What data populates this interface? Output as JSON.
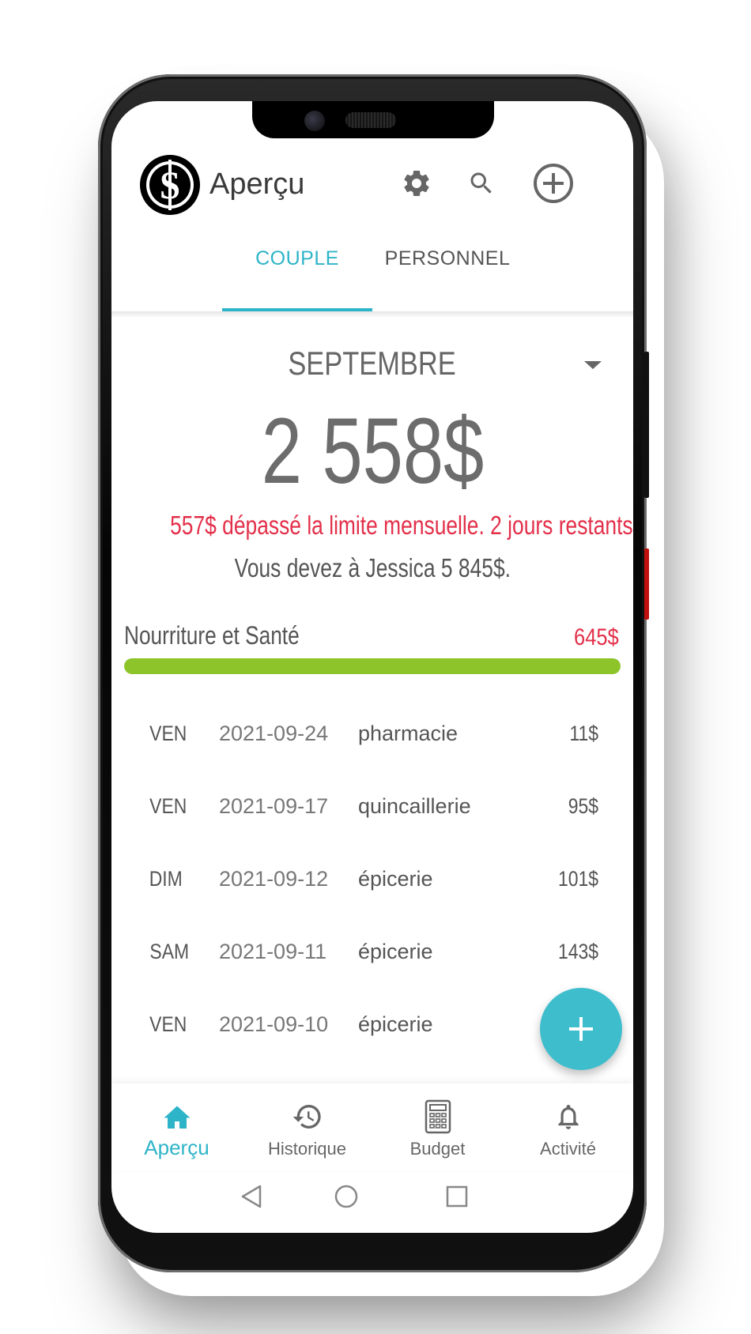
{
  "header": {
    "title": "Aperçu",
    "icons": [
      "settings-gear-icon",
      "search-icon",
      "add-circle-icon"
    ]
  },
  "tabs": [
    {
      "label": "COUPLE",
      "active": true
    },
    {
      "label": "PERSONNEL",
      "active": false
    }
  ],
  "summary": {
    "month": "SEPTEMBRE",
    "total": "2 558$",
    "warning": "557$ dépassé la limite mensuelle. 2 jours restants.",
    "owe": "Vous devez à Jessica 5 845$."
  },
  "category": {
    "label": "Nourriture et Santé",
    "amount": "645$",
    "progress_percent": 100,
    "bar_color": "#8cc42a"
  },
  "transactions": [
    {
      "day": "VEN",
      "date": "2021-09-24",
      "desc": "pharmacie",
      "amount": "11$"
    },
    {
      "day": "VEN",
      "date": "2021-09-17",
      "desc": "quincaillerie",
      "amount": "95$"
    },
    {
      "day": "DIM",
      "date": "2021-09-12",
      "desc": "épicerie",
      "amount": "101$"
    },
    {
      "day": "SAM",
      "date": "2021-09-11",
      "desc": "épicerie",
      "amount": "143$"
    },
    {
      "day": "VEN",
      "date": "2021-09-10",
      "desc": "épicerie",
      "amount": ""
    }
  ],
  "fab": {
    "icon": "plus-icon"
  },
  "bottom_nav": [
    {
      "label": "Aperçu",
      "icon": "home-icon",
      "active": true
    },
    {
      "label": "Historique",
      "icon": "history-icon",
      "active": false
    },
    {
      "label": "Budget",
      "icon": "calculator-icon",
      "active": false
    },
    {
      "label": "Activité",
      "icon": "bell-icon",
      "active": false
    }
  ],
  "colors": {
    "accent": "#2eb4c8",
    "warning": "#e3304a",
    "fab": "#3ebdcd"
  }
}
